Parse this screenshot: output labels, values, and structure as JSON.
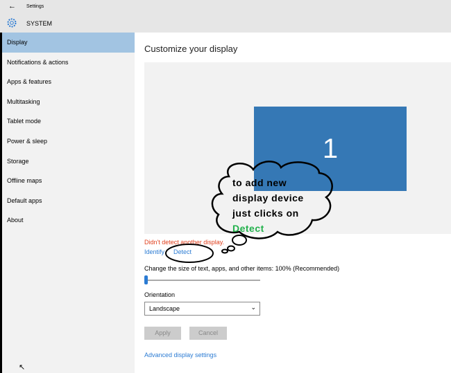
{
  "titlebar": {
    "back_icon": "arrow-left",
    "title": "Settings",
    "section_icon": "gear-icon",
    "section": "SYSTEM"
  },
  "sidebar": {
    "items": [
      {
        "label": "Display"
      },
      {
        "label": "Notifications & actions"
      },
      {
        "label": "Apps & features"
      },
      {
        "label": "Multitasking"
      },
      {
        "label": "Tablet mode"
      },
      {
        "label": "Power & sleep"
      },
      {
        "label": "Storage"
      },
      {
        "label": "Offline maps"
      },
      {
        "label": "Default apps"
      },
      {
        "label": "About"
      }
    ]
  },
  "main": {
    "title": "Customize your display",
    "monitor_number": "1",
    "warning": "Didn't detect another display.",
    "identify": "Identify",
    "detect": "Detect",
    "scale_label": "Change the size of text, apps, and other items: 100% (Recommended)",
    "scale_value_percent": 0,
    "orientation_label": "Orientation",
    "orientation_value": "Landscape",
    "apply": "Apply",
    "cancel": "Cancel",
    "advanced": "Advanced display settings"
  },
  "annotation": {
    "line1": "to add new",
    "line2": "display device",
    "line3": "just clicks on",
    "line4": "Detect",
    "accent": "#22b14c"
  },
  "colors": {
    "accent": "#2b7bd3",
    "monitor": "#3578b5",
    "warning": "#e0401e"
  }
}
